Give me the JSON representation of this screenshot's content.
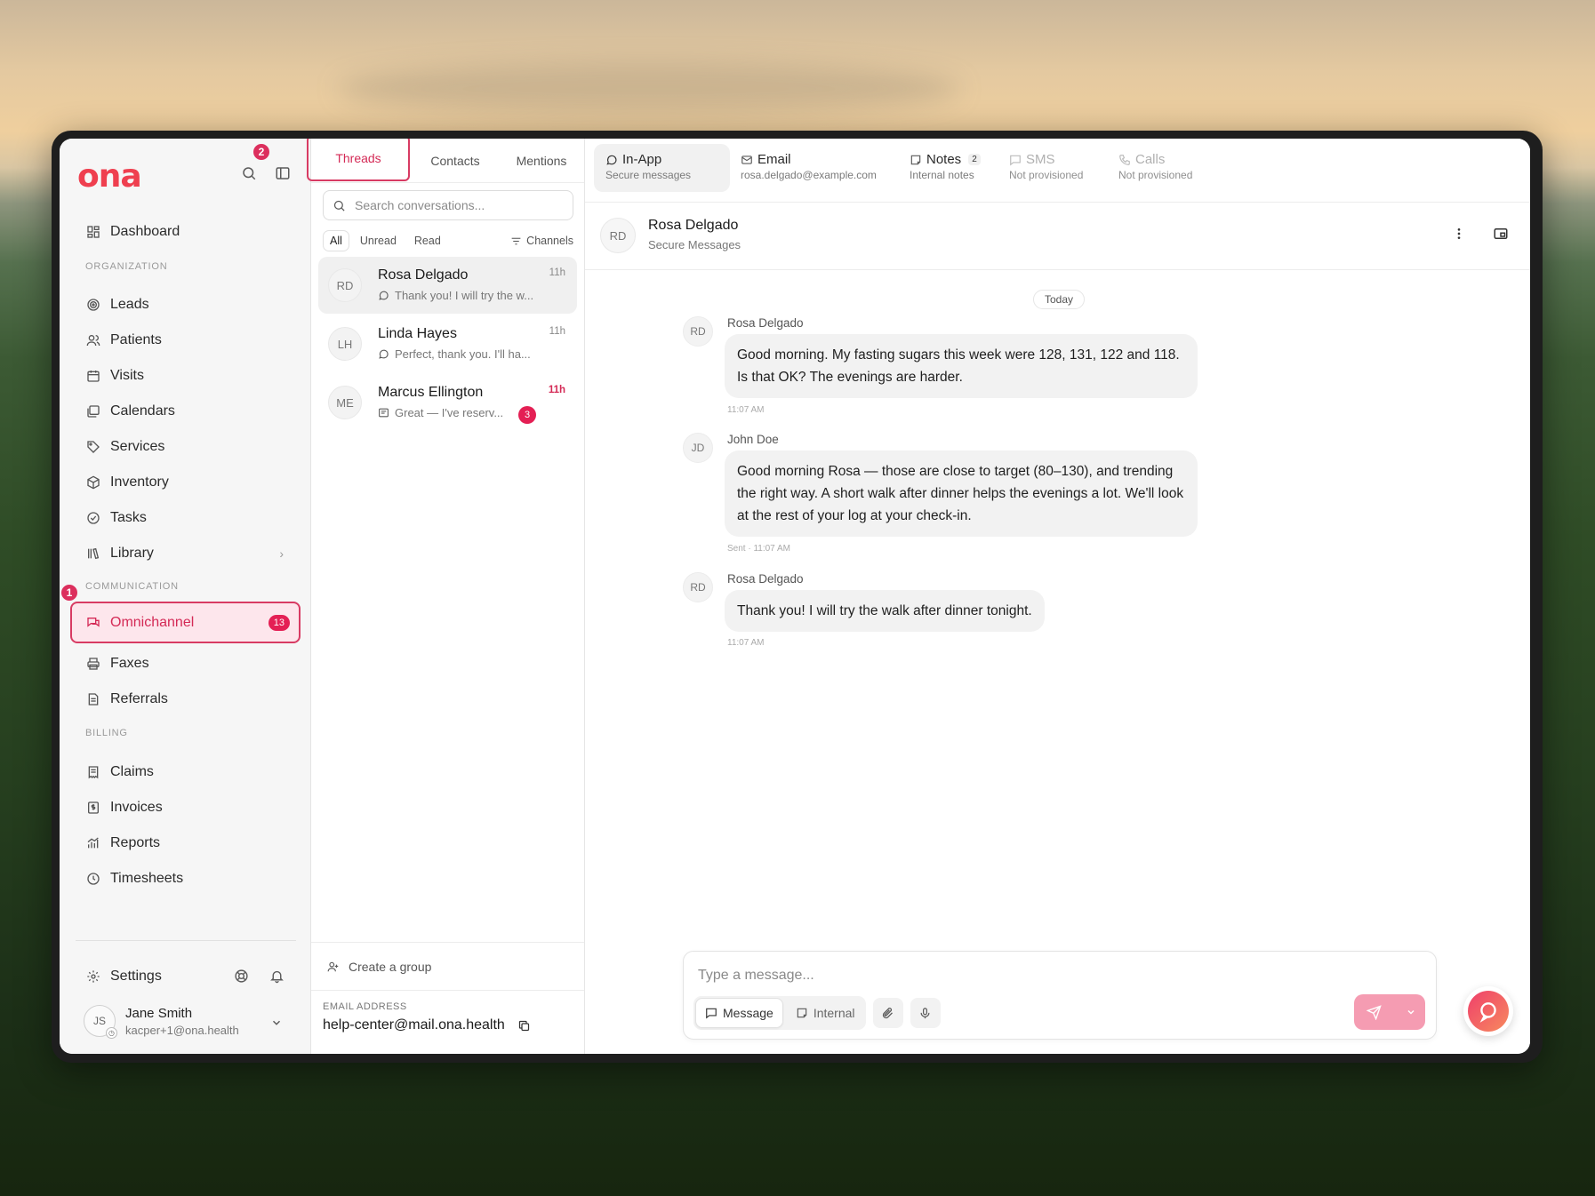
{
  "app": {
    "logo": "ona"
  },
  "annotations": {
    "first": "1",
    "second": "2"
  },
  "sidebar": {
    "dashboard": "Dashboard",
    "section_org": "ORGANIZATION",
    "org_items": [
      {
        "label": "Leads",
        "icon": "target-icon"
      },
      {
        "label": "Patients",
        "icon": "users-icon"
      },
      {
        "label": "Visits",
        "icon": "calendar-icon"
      },
      {
        "label": "Calendars",
        "icon": "calendars-icon"
      },
      {
        "label": "Services",
        "icon": "tag-icon"
      },
      {
        "label": "Inventory",
        "icon": "box-icon"
      },
      {
        "label": "Tasks",
        "icon": "check-circle-icon"
      },
      {
        "label": "Library",
        "icon": "library-icon"
      }
    ],
    "section_comm": "COMMUNICATION",
    "omnichannel": {
      "label": "Omnichannel",
      "count": "13"
    },
    "comm_items": [
      {
        "label": "Faxes",
        "icon": "printer-icon"
      },
      {
        "label": "Referrals",
        "icon": "document-icon"
      }
    ],
    "section_billing": "BILLING",
    "billing_items": [
      {
        "label": "Claims",
        "icon": "receipt-icon"
      },
      {
        "label": "Invoices",
        "icon": "invoice-icon"
      },
      {
        "label": "Reports",
        "icon": "chart-icon"
      },
      {
        "label": "Timesheets",
        "icon": "clock-icon"
      }
    ],
    "settings": "Settings",
    "user": {
      "initials": "JS",
      "name": "Jane Smith",
      "email": "kacper+1@ona.health"
    }
  },
  "threads": {
    "tabs": [
      "Threads",
      "Contacts",
      "Mentions"
    ],
    "search_placeholder": "Search conversations...",
    "filters": [
      "All",
      "Unread",
      "Read"
    ],
    "channels_filter": "Channels",
    "items": [
      {
        "initials": "RD",
        "name": "Rosa Delgado",
        "time": "11h",
        "preview": "Thank you! I will try the w..."
      },
      {
        "initials": "LH",
        "name": "Linda Hayes",
        "time": "11h",
        "preview": "Perfect, thank you. I'll ha..."
      },
      {
        "initials": "ME",
        "name": "Marcus Ellington",
        "time": "11h",
        "preview": "Great — I've reserv...",
        "unread": "3"
      }
    ],
    "create_group": "Create a group",
    "email_label": "EMAIL ADDRESS",
    "email_value": "help-center@mail.ona.health"
  },
  "channels": [
    {
      "title": "In-App",
      "sub": "Secure messages"
    },
    {
      "title": "Email",
      "sub": "rosa.delgado@example.com"
    },
    {
      "title": "Notes",
      "sub": "Internal notes",
      "count": "2"
    },
    {
      "title": "SMS",
      "sub": "Not provisioned"
    },
    {
      "title": "Calls",
      "sub": "Not provisioned"
    }
  ],
  "chat": {
    "initials": "RD",
    "name": "Rosa Delgado",
    "subtitle": "Secure Messages",
    "date_divider": "Today",
    "messages": [
      {
        "initials": "RD",
        "author": "Rosa Delgado",
        "text": "Good morning. My fasting sugars this week were 128, 131, 122 and 118. Is that OK? The evenings are harder.",
        "time": "11:07 AM"
      },
      {
        "initials": "JD",
        "author": "John Doe",
        "text": "Good morning Rosa — those are close to target (80–130), and trending the right way. A short walk after dinner helps the evenings a lot. We'll look at the rest of your log at your check-in.",
        "time": "Sent · 11:07 AM"
      },
      {
        "initials": "RD",
        "author": "Rosa Delgado",
        "text": "Thank you! I will try the walk after dinner tonight.",
        "time": "11:07 AM"
      }
    ]
  },
  "composer": {
    "placeholder": "Type a message...",
    "message_label": "Message",
    "internal_label": "Internal"
  },
  "colors": {
    "accent": "#d42a56",
    "badge": "#e41f54",
    "send": "#f59cb2"
  }
}
